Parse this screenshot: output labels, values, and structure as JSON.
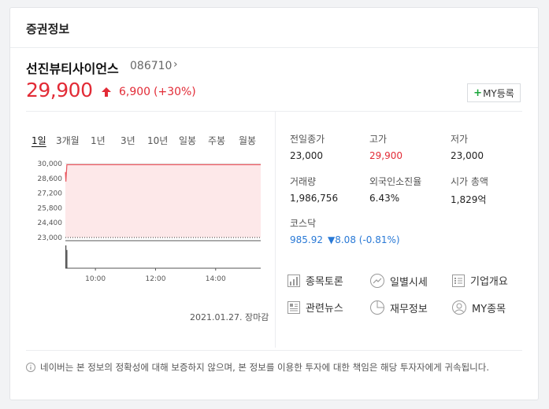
{
  "card_title": "증권정보",
  "stock": {
    "name": "선진뷰티사이언스",
    "code": "086710",
    "code_chevron": "›",
    "price": "29,900",
    "change": "6,900",
    "change_pct": "(+30%)",
    "my_button": "MY등록",
    "my_button_plus": "+"
  },
  "tabs": [
    {
      "label": "1일",
      "active": true
    },
    {
      "label": "3개월"
    },
    {
      "label": "1년"
    },
    {
      "label": "3년"
    },
    {
      "label": "10년"
    },
    {
      "label": "일봉"
    },
    {
      "label": "주봉"
    },
    {
      "label": "월봉"
    }
  ],
  "chart_data": {
    "type": "area",
    "y_ticks": [
      "30,000",
      "28,600",
      "27,200",
      "25,800",
      "24,400",
      "23,000"
    ],
    "x_ticks": [
      "10:00",
      "12:00",
      "14:00"
    ],
    "ylim": [
      23000,
      30000
    ],
    "xlim": [
      "09:00",
      "15:30"
    ],
    "baseline": 23000,
    "series": [
      {
        "x": [
          "09:00",
          "09:01",
          "09:03",
          "09:05",
          "15:30"
        ],
        "values": [
          29200,
          28300,
          29900,
          29900,
          29900
        ]
      }
    ],
    "volume": [
      {
        "x": "09:01",
        "v": 1.0
      },
      {
        "x": "09:03",
        "v": 0.8
      }
    ],
    "grid": true,
    "colors": {
      "line": "#e8575f",
      "fill": "#fde8e9",
      "grid": "#e0e0e0"
    },
    "date_label": "2021.01.27. 장마감"
  },
  "stats": {
    "prev_close_label": "전일종가",
    "prev_close": "23,000",
    "high_label": "고가",
    "high": "29,900",
    "low_label": "저가",
    "low": "23,000",
    "volume_label": "거래량",
    "volume": "1,986,756",
    "foreign_label": "외국인소진율",
    "foreign": "6.43%",
    "mcap_label": "시가 총액",
    "mcap": "1,829억",
    "index_label": "코스닥",
    "index_value": "985.92",
    "index_change": "▼8.08 (-0.81%)"
  },
  "links": [
    {
      "label": "종목토론",
      "icon": "bar-chart-icon"
    },
    {
      "label": "일별시세",
      "icon": "trend-icon"
    },
    {
      "label": "기업개요",
      "icon": "list-icon"
    },
    {
      "label": "관련뉴스",
      "icon": "news-icon"
    },
    {
      "label": "재무정보",
      "icon": "pie-icon"
    },
    {
      "label": "MY종목",
      "icon": "user-icon"
    }
  ],
  "notice": "네이버는 본 정보의 정확성에 대해 보증하지 않으며, 본 정보를 이용한 투자에 대한 책임은 해당 투자자에게 귀속됩니다.",
  "colors": {
    "up": "#e22b36",
    "down": "#2979d6",
    "accent_green": "#19a63a"
  }
}
